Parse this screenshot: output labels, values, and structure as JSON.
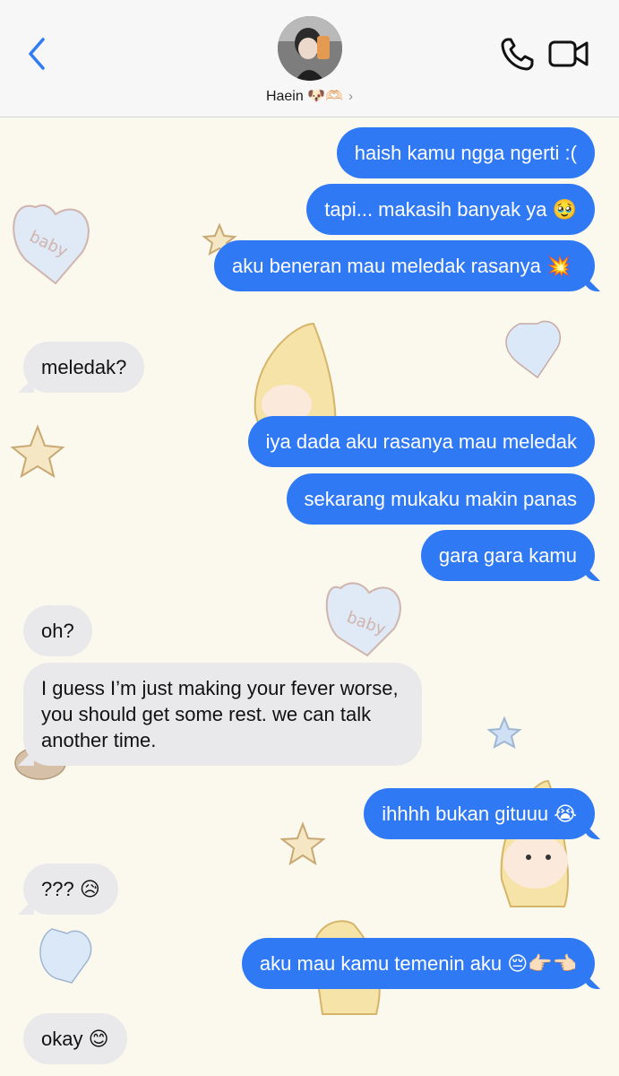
{
  "header": {
    "contact_name": "Haein 🐶🫶🏻",
    "chevron": "›"
  },
  "messages": [
    {
      "from": "me",
      "text": "haish kamu ngga ngerti :("
    },
    {
      "from": "me",
      "text": "tapi... makasih banyak ya 🥹"
    },
    {
      "from": "me",
      "text": "aku beneran mau meledak rasanya 💥"
    },
    {
      "from": "them",
      "text": "meledak?"
    },
    {
      "from": "me",
      "text": "iya dada aku rasanya mau meledak"
    },
    {
      "from": "me",
      "text": "sekarang mukaku makin panas"
    },
    {
      "from": "me",
      "text": "gara gara kamu"
    },
    {
      "from": "them",
      "text": "oh?"
    },
    {
      "from": "them",
      "text": "I guess I’m just making your fever worse, you should get some rest. we can talk another time."
    },
    {
      "from": "me",
      "text": "ihhhh bukan gituuu 😭"
    },
    {
      "from": "them",
      "text": "??? 😥"
    },
    {
      "from": "me",
      "text": "aku mau kamu temenin aku 😔👉🏻👈🏻"
    },
    {
      "from": "them",
      "text": "okay 😊"
    }
  ],
  "colors": {
    "outgoing_bubble": "#3079f4",
    "incoming_bubble": "#e9e9eb",
    "accent": "#2f7cf6",
    "wallpaper": "#fbf8ee"
  },
  "icons": [
    "back-chevron-icon",
    "phone-icon",
    "video-camera-icon"
  ]
}
